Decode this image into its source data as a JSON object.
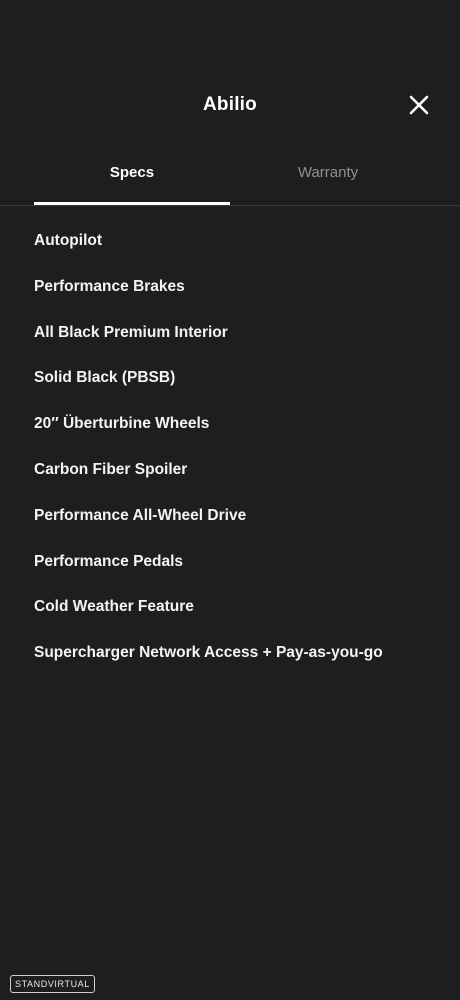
{
  "header": {
    "title": "Abilio",
    "close_icon": "close-icon"
  },
  "tabs": [
    {
      "label": "Specs",
      "active": true
    },
    {
      "label": "Warranty",
      "active": false
    }
  ],
  "specs": [
    "Autopilot",
    "Performance Brakes",
    "All Black Premium Interior",
    "Solid Black (PBSB)",
    "20′′ Überturbine Wheels",
    "Carbon Fiber Spoiler",
    "Performance All-Wheel Drive",
    "Performance Pedals",
    "Cold Weather Feature",
    "Supercharger Network Access + Pay-as-you-go"
  ],
  "watermark": "STANDVIRTUAL",
  "colors": {
    "background": "#1d1e1e",
    "text": "#ffffff",
    "inactive_tab": "#8f9090",
    "divider": "#3a3b3b"
  }
}
